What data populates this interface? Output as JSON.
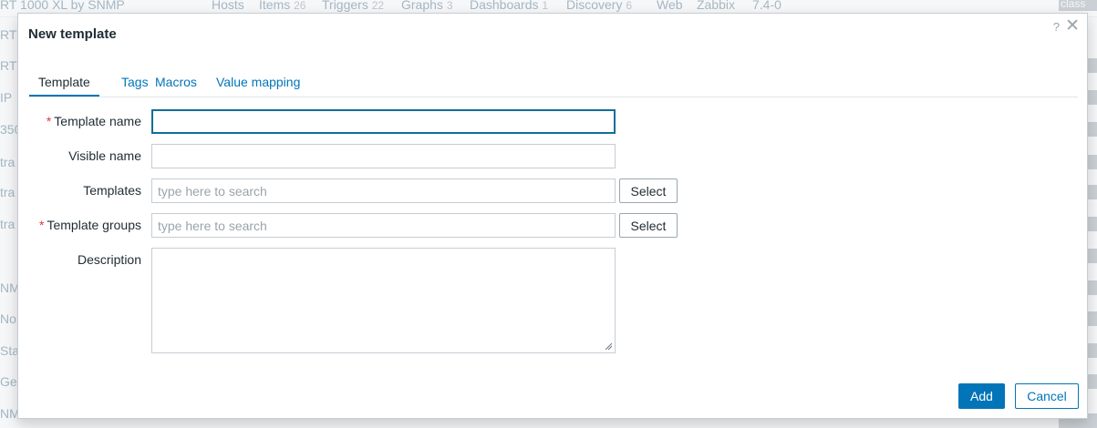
{
  "background": {
    "header_row": {
      "template": "RT 1000 XL by SNMP",
      "links": [
        {
          "label": "Hosts",
          "count": ""
        },
        {
          "label": "Items",
          "count": "26"
        },
        {
          "label": "Triggers",
          "count": "22"
        },
        {
          "label": "Graphs",
          "count": "3"
        },
        {
          "label": "Dashboards",
          "count": "1"
        },
        {
          "label": "Discovery",
          "count": "6"
        },
        {
          "label": "Web",
          "count": ""
        }
      ],
      "vendor": "Zabbix",
      "version": "7.4-0",
      "tag": "class"
    },
    "left_fragments": [
      "RT",
      "RT",
      "IP",
      "350",
      "tra",
      "tra",
      "tra",
      "",
      "NMP",
      "No",
      "Sta",
      "Ge",
      "NMP"
    ]
  },
  "modal": {
    "title": "New template",
    "help": "?",
    "close": "✕",
    "tabs": [
      {
        "label": "Template",
        "active": true
      },
      {
        "label": "Tags",
        "active": false
      },
      {
        "label": "Macros",
        "active": false
      },
      {
        "label": "Value mapping",
        "active": false
      }
    ],
    "form": {
      "template_name": {
        "label": "Template name",
        "required": true,
        "value": ""
      },
      "visible_name": {
        "label": "Visible name",
        "required": false,
        "value": ""
      },
      "templates": {
        "label": "Templates",
        "required": false,
        "placeholder": "type here to search",
        "button": "Select"
      },
      "template_groups": {
        "label": "Template groups",
        "required": true,
        "placeholder": "type here to search",
        "button": "Select"
      },
      "description": {
        "label": "Description",
        "value": ""
      }
    },
    "buttons": {
      "add": "Add",
      "cancel": "Cancel"
    }
  },
  "colors": {
    "accent": "#0275b8",
    "required": "#e33734",
    "focus_border": "#126e96"
  }
}
